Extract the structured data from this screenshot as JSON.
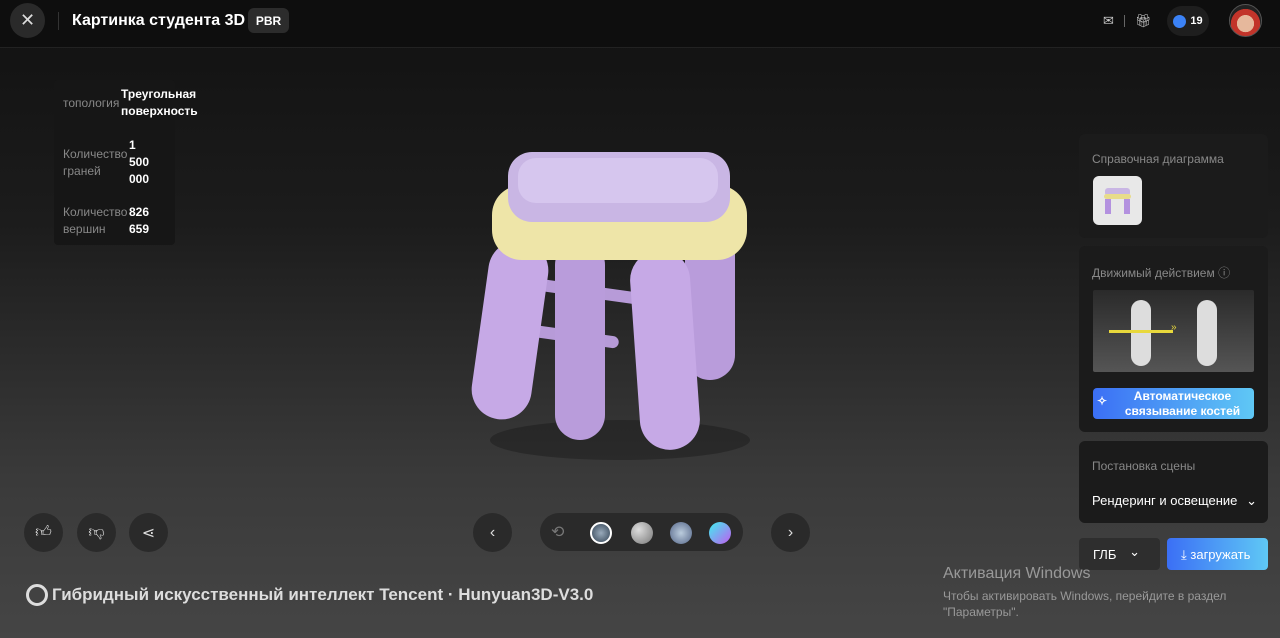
{
  "header": {
    "title": "Картинка студента 3D",
    "badge": "PBR",
    "credits": "19",
    "icons": [
      "close-icon",
      "mail-icon",
      "gift-icon",
      "credit-icon",
      "avatar"
    ]
  },
  "info": {
    "rows": [
      {
        "label": "топология",
        "value": "Треугольная поверхность"
      },
      {
        "label": "Количество граней",
        "value_lines": [
          "1",
          "500",
          "000"
        ]
      },
      {
        "label": "Количество вершин",
        "value_lines": [
          "826",
          "659"
        ]
      }
    ]
  },
  "side": {
    "reference_title": "Справочная диаграмма",
    "motion_title": "Движимый действием",
    "auto_rig": "Автоматическое связывание костей",
    "scene_title": "Постановка сцены",
    "render_select": "Рендеринг и освещение",
    "format": "ГЛБ",
    "download": "загружать"
  },
  "footer": {
    "brand": "Гибридный искусственный интеллект Tencent · Hunyuan3D-V3.0"
  },
  "watermark": {
    "title": "Активация Windows",
    "text": "Чтобы активировать Windows, перейдите в раздел \"Параметры\"."
  },
  "colors": {
    "accent_gradient": [
      "#3b6ff5",
      "#5fc8f5"
    ],
    "seat_top": "#c9b6e4",
    "seat_rim": "#eee5a8",
    "legs": "#c6a9e6"
  }
}
